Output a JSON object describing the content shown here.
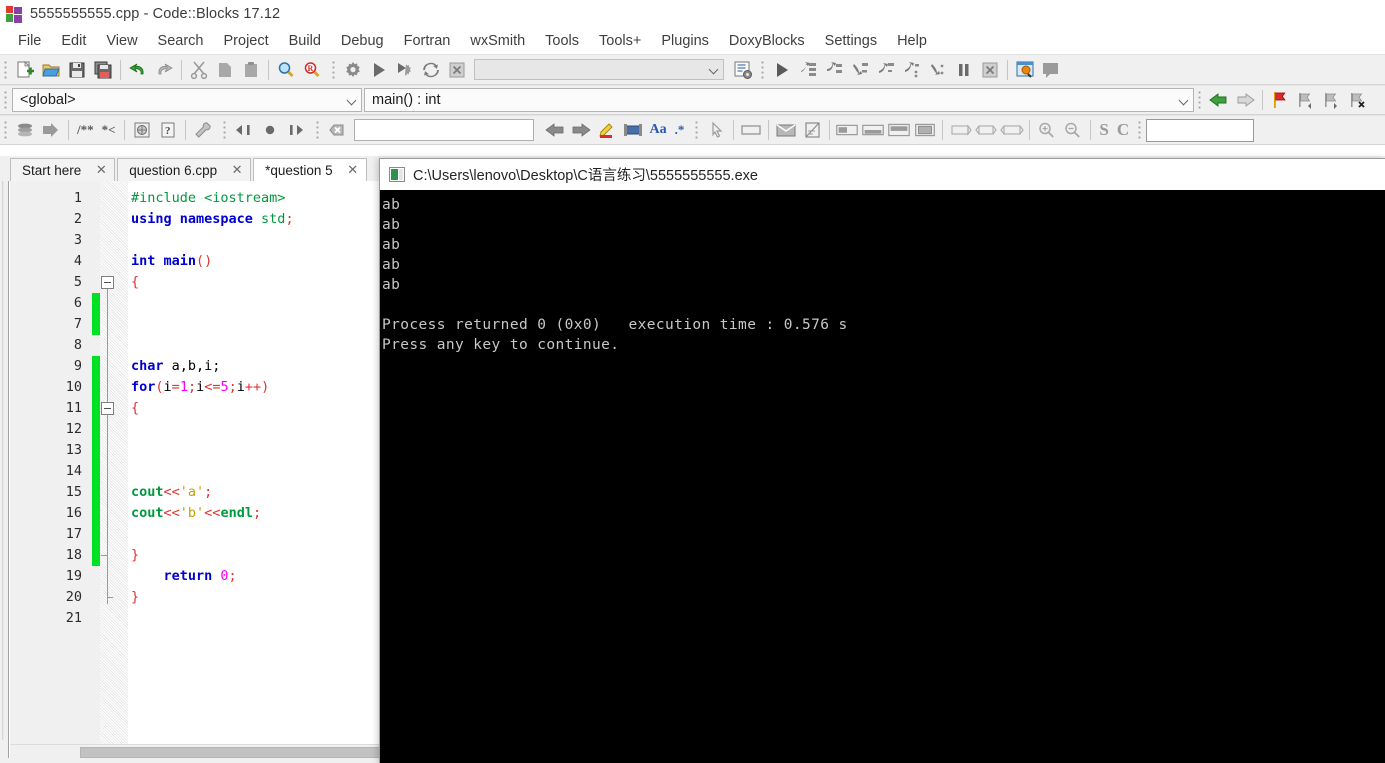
{
  "window": {
    "title": "5555555555.cpp - Code::Blocks 17.12",
    "logo_icon": "codeblocks-logo-icon"
  },
  "menubar": {
    "items": [
      {
        "label": "File"
      },
      {
        "label": "Edit"
      },
      {
        "label": "View"
      },
      {
        "label": "Search"
      },
      {
        "label": "Project"
      },
      {
        "label": "Build"
      },
      {
        "label": "Debug"
      },
      {
        "label": "Fortran"
      },
      {
        "label": "wxSmith"
      },
      {
        "label": "Tools"
      },
      {
        "label": "Tools+"
      },
      {
        "label": "Plugins"
      },
      {
        "label": "DoxyBlocks"
      },
      {
        "label": "Settings"
      },
      {
        "label": "Help"
      }
    ]
  },
  "toolbar_main": {
    "icons": [
      {
        "name": "new-file-icon"
      },
      {
        "name": "open-file-icon"
      },
      {
        "name": "save-icon"
      },
      {
        "name": "save-all-icon"
      },
      {
        "name": "undo-icon"
      },
      {
        "name": "redo-icon"
      },
      {
        "name": "cut-icon"
      },
      {
        "name": "copy-icon"
      },
      {
        "name": "paste-icon"
      },
      {
        "name": "find-icon"
      },
      {
        "name": "replace-icon"
      }
    ]
  },
  "toolbar_compiler": {
    "icons": [
      {
        "name": "build-icon"
      },
      {
        "name": "run-icon"
      },
      {
        "name": "build-and-run-icon"
      },
      {
        "name": "rebuild-icon"
      },
      {
        "name": "abort-icon"
      }
    ],
    "target_value": "",
    "target_placeholder": "",
    "select_target_icon": "select-target-icon"
  },
  "toolbar_debugger": {
    "icons": [
      {
        "name": "debug-continue-icon"
      },
      {
        "name": "debug-run-to-cursor-icon"
      },
      {
        "name": "debug-next-line-icon"
      },
      {
        "name": "debug-step-into-icon"
      },
      {
        "name": "debug-step-out-icon"
      },
      {
        "name": "debug-next-instruction-icon"
      },
      {
        "name": "debug-step-into-instruction-icon"
      },
      {
        "name": "debug-break-icon"
      },
      {
        "name": "debug-stop-icon"
      },
      {
        "name": "debugging-windows-icon"
      },
      {
        "name": "various-info-icon"
      }
    ]
  },
  "scopebar": {
    "scope_value": "<global>",
    "function_value": "main() : int",
    "scope_chevron_icon": "chevron-down-icon",
    "function_chevron_icon": "chevron-down-icon",
    "nav_icons": [
      {
        "name": "browse-back-icon"
      },
      {
        "name": "browse-forward-icon"
      },
      {
        "name": "toggle-bookmark-icon"
      },
      {
        "name": "previous-bookmark-icon"
      },
      {
        "name": "next-bookmark-icon"
      },
      {
        "name": "clear-all-bookmarks-icon"
      }
    ]
  },
  "toolbar_doxyblocks": {
    "icons": [
      {
        "name": "doxyblocks-extract-icon"
      },
      {
        "name": "doxyblocks-run-icon"
      },
      {
        "name": "doxyblocks-blockcomment-icon"
      },
      {
        "name": "doxyblocks-linecomment-icon"
      },
      {
        "name": "doxyblocks-html-icon"
      },
      {
        "name": "doxyblocks-help-icon"
      },
      {
        "name": "doxyblocks-config-icon"
      }
    ],
    "block_comment_label": "/**",
    "line_comment_label": "*<"
  },
  "toolbar_fortran": {
    "icons": [
      {
        "name": "jump-back-icon"
      },
      {
        "name": "jump-home-icon"
      },
      {
        "name": "jump-forward-icon"
      }
    ]
  },
  "toolbar_find": {
    "icons": [
      {
        "name": "clear-search-icon"
      },
      {
        "name": "search-previous-icon"
      },
      {
        "name": "search-next-icon"
      },
      {
        "name": "highlight-occurrences-icon"
      },
      {
        "name": "selected-text-only-icon"
      },
      {
        "name": "match-case-icon"
      },
      {
        "name": "regex-icon"
      }
    ],
    "search_value": "",
    "search_placeholder": "",
    "match_case_label": "Aa",
    "regex_label": ".*"
  },
  "toolbar_wxsmith": {
    "icons": [
      {
        "name": "pointer-tool-icon"
      },
      {
        "name": "panel-icon"
      },
      {
        "name": "dialog-icon"
      },
      {
        "name": "frame-icon"
      },
      {
        "name": "sizer-h-icon"
      },
      {
        "name": "sizer-v-icon"
      },
      {
        "name": "sizer-grid-icon"
      },
      {
        "name": "sizer-box-icon"
      },
      {
        "name": "stretch-left-icon"
      },
      {
        "name": "stretch-center-icon"
      },
      {
        "name": "stretch-right-icon"
      },
      {
        "name": "zoom-in-icon"
      },
      {
        "name": "zoom-out-icon"
      }
    ],
    "smart_indent_label": "S",
    "comment_label": "C",
    "extra_value": "",
    "extra_placeholder": ""
  },
  "tabs": [
    {
      "label": "Start here",
      "active": false,
      "close_icon": "close-icon"
    },
    {
      "label": "question 6.cpp",
      "active": false,
      "close_icon": "close-icon"
    },
    {
      "label": "*question 5",
      "active": true,
      "close_icon": "close-icon"
    }
  ],
  "editor": {
    "line_numbers": [
      "1",
      "2",
      "3",
      "4",
      "5",
      "6",
      "7",
      "8",
      "9",
      "10",
      "11",
      "12",
      "13",
      "14",
      "15",
      "16",
      "17",
      "18",
      "19",
      "20",
      "21"
    ],
    "lines": [
      {
        "n": 1,
        "changed": false,
        "tokens": [
          {
            "t": "#include ",
            "c": "k-pre"
          },
          {
            "t": "<iostream>",
            "c": "k-pre"
          }
        ]
      },
      {
        "n": 2,
        "changed": false,
        "tokens": [
          {
            "t": "using namespace ",
            "c": "k-kw"
          },
          {
            "t": "std",
            "c": "k-pre"
          },
          {
            "t": ";",
            "c": "k-op"
          }
        ]
      },
      {
        "n": 3,
        "changed": false,
        "tokens": []
      },
      {
        "n": 4,
        "changed": false,
        "tokens": [
          {
            "t": "int ",
            "c": "k-kw"
          },
          {
            "t": "main",
            "c": "k-kw"
          },
          {
            "t": "()",
            "c": "k-op"
          }
        ]
      },
      {
        "n": 5,
        "changed": false,
        "tokens": [
          {
            "t": "{",
            "c": "k-brc"
          }
        ]
      },
      {
        "n": 6,
        "changed": true,
        "tokens": []
      },
      {
        "n": 7,
        "changed": true,
        "tokens": []
      },
      {
        "n": 8,
        "changed": false,
        "tokens": []
      },
      {
        "n": 9,
        "changed": true,
        "tokens": [
          {
            "t": "char ",
            "c": "k-kw"
          },
          {
            "t": "a,b,i;",
            "c": "code"
          }
        ]
      },
      {
        "n": 10,
        "changed": true,
        "tokens": [
          {
            "t": "for",
            "c": "k-kw"
          },
          {
            "t": "(",
            "c": "k-op"
          },
          {
            "t": "i",
            "c": "code"
          },
          {
            "t": "=",
            "c": "k-op"
          },
          {
            "t": "1",
            "c": "k-num"
          },
          {
            "t": ";",
            "c": "k-op"
          },
          {
            "t": "i",
            "c": "code"
          },
          {
            "t": "<=",
            "c": "k-op"
          },
          {
            "t": "5",
            "c": "k-num"
          },
          {
            "t": ";",
            "c": "k-op"
          },
          {
            "t": "i",
            "c": "code"
          },
          {
            "t": "++)",
            "c": "k-op"
          }
        ]
      },
      {
        "n": 11,
        "changed": true,
        "tokens": [
          {
            "t": "{",
            "c": "k-brc"
          }
        ]
      },
      {
        "n": 12,
        "changed": true,
        "tokens": []
      },
      {
        "n": 13,
        "changed": true,
        "tokens": []
      },
      {
        "n": 14,
        "changed": true,
        "tokens": []
      },
      {
        "n": 15,
        "changed": true,
        "tokens": [
          {
            "t": "cout",
            "c": "k-fn"
          },
          {
            "t": "<<",
            "c": "k-op"
          },
          {
            "t": "'a'",
            "c": "k-str"
          },
          {
            "t": ";",
            "c": "k-op"
          }
        ]
      },
      {
        "n": 16,
        "changed": true,
        "tokens": [
          {
            "t": "cout",
            "c": "k-fn"
          },
          {
            "t": "<<",
            "c": "k-op"
          },
          {
            "t": "'b'",
            "c": "k-str"
          },
          {
            "t": "<<",
            "c": "k-op"
          },
          {
            "t": "endl",
            "c": "k-fn"
          },
          {
            "t": ";",
            "c": "k-op"
          }
        ]
      },
      {
        "n": 17,
        "changed": true,
        "tokens": []
      },
      {
        "n": 18,
        "changed": true,
        "tokens": [
          {
            "t": "}",
            "c": "k-brc"
          }
        ]
      },
      {
        "n": 19,
        "changed": false,
        "tokens": [
          {
            "t": "    return ",
            "c": "k-kw"
          },
          {
            "t": "0",
            "c": "k-num"
          },
          {
            "t": ";",
            "c": "k-op"
          }
        ]
      },
      {
        "n": 20,
        "changed": false,
        "tokens": [
          {
            "t": "}",
            "c": "k-brc"
          }
        ]
      },
      {
        "n": 21,
        "changed": false,
        "tokens": []
      }
    ],
    "raw_text": "#include <iostream>\nusing namespace std;\n\nint main()\n{\n\n\n\nchar a,b,i;\nfor(i=1;i<=5;i++)\n{\n\n\n\ncout<<'a';\ncout<<'b'<<endl;\n\n}\n    return 0;\n}\n"
  },
  "console": {
    "title": "C:\\Users\\lenovo\\Desktop\\C语言练习\\5555555555.exe",
    "icon": "console-window-icon",
    "output": [
      "ab",
      "ab",
      "ab",
      "ab",
      "ab",
      "",
      "Process returned 0 (0x0)   execution time : 0.576 s",
      "Press any key to continue."
    ]
  },
  "colors": {
    "console_background": "#000000",
    "console_text": "#c7c7c7",
    "change_bar": "#00e024",
    "toolbar_background": "#f0f0f0",
    "editor_background": "#ffffff",
    "keyword": "#0000d0",
    "string": "#c8a000",
    "number": "#ff00ff",
    "operator": "#e03232",
    "preprocessor": "#009a3e"
  }
}
